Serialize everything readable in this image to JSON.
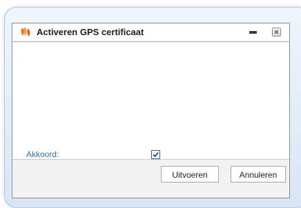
{
  "window": {
    "title": "Activeren GPS certificaat",
    "title_icon": "butterfly-app-icon",
    "minimize_icon": "minimize-icon",
    "close_icon": "close-icon"
  },
  "form": {
    "akkoord_label": "Akkoord:",
    "akkoord_checked": true
  },
  "footer": {
    "execute_label": "Uitvoeren",
    "cancel_label": "Annuleren"
  },
  "colors": {
    "label_blue": "#3c6fa8",
    "checkbox_border": "#2f5f9e",
    "app_icon_orange": "#e8742a"
  }
}
